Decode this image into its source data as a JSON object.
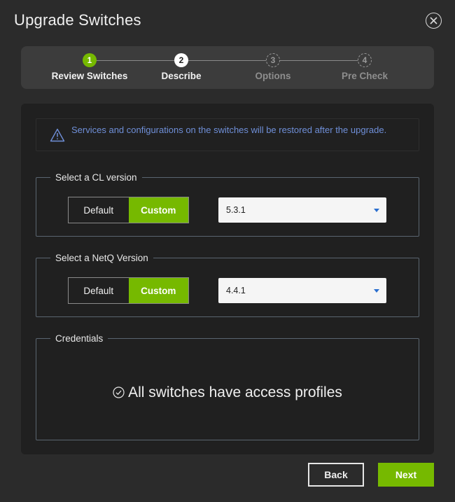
{
  "dialog": {
    "title": "Upgrade Switches",
    "close_icon": "close-circle-icon"
  },
  "stepper": {
    "steps": [
      {
        "number": "1",
        "label": "Review Switches",
        "state": "done"
      },
      {
        "number": "2",
        "label": "Describe",
        "state": "active"
      },
      {
        "number": "3",
        "label": "Options",
        "state": "pending"
      },
      {
        "number": "4",
        "label": "Pre Check",
        "state": "pending"
      }
    ]
  },
  "alert": {
    "icon": "warning-triangle-icon",
    "text": "Services and configurations on the switches will be restored after the upgrade."
  },
  "cl_version": {
    "legend": "Select a CL version",
    "options": [
      "Default",
      "Custom"
    ],
    "selected_option": "Custom",
    "value": "5.3.1"
  },
  "netq_version": {
    "legend": "Select a NetQ Version",
    "options": [
      "Default",
      "Custom"
    ],
    "selected_option": "Custom",
    "value": "4.4.1"
  },
  "credentials": {
    "legend": "Credentials",
    "icon": "check-circle-icon",
    "message": "All switches have access profiles"
  },
  "footer": {
    "back_label": "Back",
    "next_label": "Next"
  },
  "colors": {
    "accent_green": "#76b900",
    "info_blue": "#6f8fd8",
    "background": "#2b2b2b",
    "panel": "#202020"
  }
}
